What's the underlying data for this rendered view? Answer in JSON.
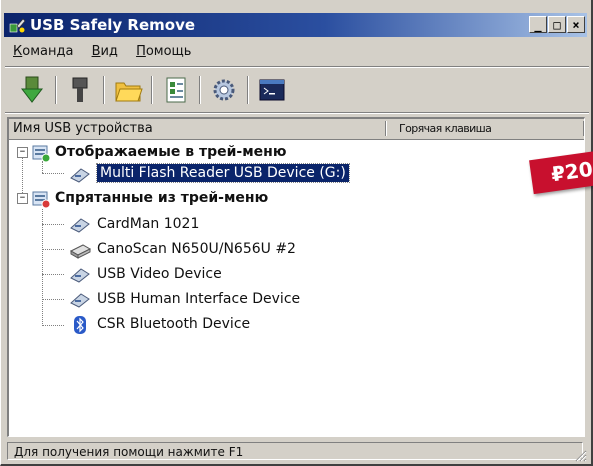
{
  "window": {
    "title": "USB Safely Remove",
    "controls": {
      "minimize": "_",
      "maximize": "□",
      "close": "×"
    }
  },
  "menu": {
    "items": [
      {
        "label": "Команда",
        "underline": "К",
        "rest": "оманда"
      },
      {
        "label": "Вид",
        "underline": "В",
        "rest": "ид"
      },
      {
        "label": "Помощь",
        "underline": "П",
        "rest": "омощь"
      }
    ]
  },
  "toolbar": {
    "buttons": [
      {
        "icon": "stop-device-icon"
      },
      {
        "icon": "usb-plug-icon"
      },
      {
        "icon": "folder-icon"
      },
      {
        "icon": "list-view-icon"
      },
      {
        "icon": "settings-gear-icon"
      },
      {
        "icon": "command-prompt-icon"
      }
    ]
  },
  "columns": {
    "name": "Имя USB устройства",
    "hotkey": "Горячая клавиша"
  },
  "tree": {
    "groups": [
      {
        "label": "Отображаемые в трей-меню",
        "expander": "−",
        "items": [
          {
            "label": "Multi Flash Reader USB Device (G:)",
            "selected": true
          }
        ]
      },
      {
        "label": "Спрятанные из трей-меню",
        "expander": "−",
        "items": [
          {
            "label": "CardMan 1021",
            "selected": false
          },
          {
            "label": "CanoScan N650U/N656U #2",
            "selected": false
          },
          {
            "label": "USB Video Device",
            "selected": false
          },
          {
            "label": "USB Human Interface Device",
            "selected": false
          },
          {
            "label": "CSR Bluetooth Device",
            "selected": false
          }
        ]
      }
    ]
  },
  "overlay": {
    "price": "₽20"
  },
  "status": {
    "text": "Для получения помощи нажмите F1"
  },
  "colors": {
    "selection": "#0a246a",
    "titlebar_start": "#0b236b",
    "titlebar_end": "#a8c2e6",
    "price_tag": "#c8102e"
  }
}
